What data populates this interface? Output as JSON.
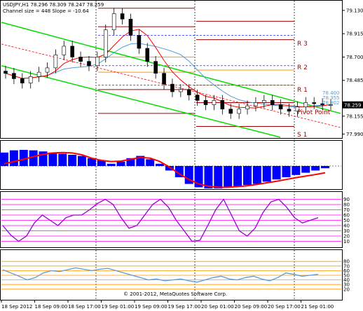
{
  "header": {
    "symbol_line": "USDJPY,H1  78.296 78.309 78.247 78.259",
    "channel_line": "Channel size = 448 Slope = -10.64"
  },
  "copyright": "© 2001-2012, MetaQuotes Software Corp.",
  "colors": {
    "background": "#ffffff",
    "channel_green": "#00dd00",
    "pivot_red": "#a00000",
    "pivot_orange": "#ff9900",
    "ma_red": "#ff0000",
    "ma_blue": "#5b9bd5",
    "indicator_blue": "#0000ff",
    "stoch_purple": "#9900cc",
    "magenta_grid": "#ff00ff",
    "price_box": "#000000"
  },
  "chart_data": [
    {
      "type": "line",
      "panel": "price",
      "title": "USDJPY,H1",
      "y_ticks": [
        "79.130",
        "78.915",
        "78.700",
        "78.485",
        "78.270",
        "78.155",
        "77.990"
      ],
      "ylim": [
        77.96,
        79.2
      ],
      "current_price": "78.259",
      "price_tags": [
        "78.400",
        "78.355",
        "78.302"
      ],
      "pivot_labels": [
        "R 3",
        "R 2",
        "R 1",
        "Pivot Point",
        "S 1"
      ],
      "x_labels": [
        "18 Sep 2012",
        "18 Sep 09:00",
        "18 Sep 17:00",
        "19 Sep 01:00",
        "19 Sep 09:00",
        "19 Sep 17:00",
        "20 Sep 01:00",
        "20 Sep 09:00",
        "20 Sep 17:00",
        "21 Sep 01:00"
      ],
      "close": [
        78.55,
        78.5,
        78.46,
        78.52,
        78.56,
        78.6,
        78.72,
        78.8,
        78.7,
        78.66,
        78.62,
        78.7,
        78.95,
        79.1,
        79.05,
        78.9,
        78.78,
        78.66,
        78.55,
        78.45,
        78.38,
        78.4,
        78.35,
        78.3,
        78.26,
        78.3,
        78.22,
        78.18,
        78.22,
        78.25,
        78.28,
        78.3,
        78.26,
        78.22,
        78.2,
        78.24,
        78.28,
        78.27,
        78.26,
        78.26
      ]
    },
    {
      "type": "bar",
      "panel": "oscillator",
      "y_ticks": [],
      "histogram": [
        0.6,
        0.7,
        0.72,
        0.7,
        0.65,
        0.6,
        0.55,
        0.5,
        0.45,
        0.35,
        0.25,
        0.1,
        0.2,
        0.35,
        0.45,
        0.3,
        0.1,
        -0.2,
        -0.5,
        -0.8,
        -0.95,
        -1.0,
        -1.0,
        -0.95,
        -0.9,
        -0.85,
        -0.8,
        -0.7,
        -0.6,
        -0.5,
        -0.4,
        -0.3,
        -0.2,
        -0.1
      ],
      "signal": [
        0.1,
        0.2,
        0.3,
        0.42,
        0.52,
        0.58,
        0.6,
        0.58,
        0.5,
        0.35,
        0.25,
        0.2,
        0.22,
        0.3,
        0.38,
        0.35,
        0.2,
        -0.05,
        -0.35,
        -0.6,
        -0.8,
        -0.9,
        -0.95,
        -0.95,
        -0.92,
        -0.88,
        -0.82,
        -0.75,
        -0.68,
        -0.6,
        -0.52,
        -0.45,
        -0.38,
        -0.3
      ]
    },
    {
      "type": "line",
      "panel": "stochastic",
      "y_ticks": [
        "90",
        "80",
        "70",
        "60",
        "50",
        "40",
        "30",
        "20",
        "10"
      ],
      "ylim": [
        0,
        100
      ],
      "values": [
        40,
        22,
        10,
        20,
        45,
        60,
        50,
        40,
        55,
        60,
        60,
        70,
        82,
        90,
        80,
        55,
        35,
        40,
        60,
        80,
        90,
        75,
        50,
        30,
        10,
        12,
        40,
        70,
        90,
        60,
        30,
        20,
        35,
        65,
        85,
        90,
        75,
        55,
        45,
        50,
        55
      ]
    },
    {
      "type": "line",
      "panel": "rsi",
      "y_ticks": [
        "80",
        "70",
        "60",
        "50",
        "40",
        "30",
        "20"
      ],
      "ylim": [
        0,
        100
      ],
      "values": [
        62,
        55,
        48,
        40,
        45,
        55,
        60,
        58,
        62,
        66,
        63,
        60,
        63,
        65,
        60,
        55,
        50,
        45,
        40,
        42,
        38,
        40,
        42,
        38,
        35,
        40,
        45,
        48,
        42,
        40,
        45,
        48,
        42,
        38,
        45,
        55,
        52,
        48,
        50,
        52
      ]
    }
  ]
}
